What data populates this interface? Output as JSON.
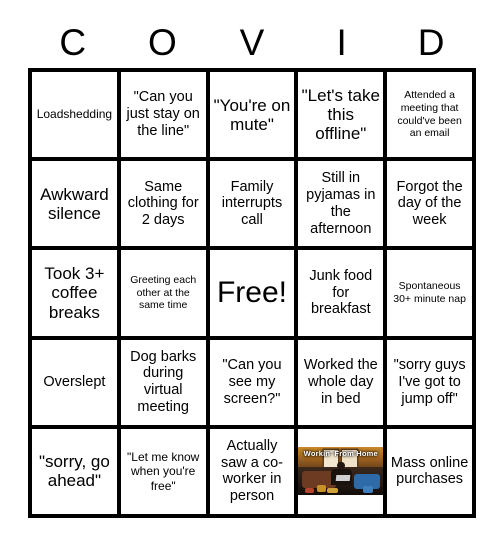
{
  "card": {
    "title_letters": [
      "C",
      "O",
      "V",
      "I",
      "D"
    ],
    "free_space_label": "Free!"
  },
  "grid": {
    "rows": 5,
    "columns": 5,
    "cells": [
      {
        "text": "Loadshedding",
        "size": "s"
      },
      {
        "text": "\"Can you just stay on the line\"",
        "size": "m"
      },
      {
        "text": "\"You're on mute\"",
        "size": "l"
      },
      {
        "text": "\"Let's take this offline\"",
        "size": "l"
      },
      {
        "text": "Attended a meeting that could've been an email",
        "size": "xs"
      },
      {
        "text": "Awkward silence",
        "size": "l"
      },
      {
        "text": "Same clothing for 2 days",
        "size": "m"
      },
      {
        "text": "Family interrupts call",
        "size": "m"
      },
      {
        "text": "Still in pyjamas in the afternoon",
        "size": "m"
      },
      {
        "text": "Forgot the day of the week",
        "size": "m"
      },
      {
        "text": "Took 3+ coffee breaks",
        "size": "l"
      },
      {
        "text": "Greeting each other at the same time",
        "size": "xs"
      },
      {
        "text": "Free!",
        "size": "xl"
      },
      {
        "text": "Junk food for breakfast",
        "size": "m"
      },
      {
        "text": "Spontaneous 30+ minute nap",
        "size": "xs"
      },
      {
        "text": "Overslept",
        "size": "m"
      },
      {
        "text": "Dog barks during virtual meeting",
        "size": "m"
      },
      {
        "text": "\"Can you see my screen?\"",
        "size": "m"
      },
      {
        "text": "Worked the whole day in bed",
        "size": "m"
      },
      {
        "text": "\"sorry guys I've got to jump off\"",
        "size": "m"
      },
      {
        "text": "\"sorry, go ahead\"",
        "size": "l"
      },
      {
        "text": "\"Let me know when you're free\"",
        "size": "s"
      },
      {
        "text": "Actually saw a co-worker in person",
        "size": "m"
      },
      {
        "text": "",
        "size": "m",
        "image": true,
        "image_caption": "Workin' From Home"
      },
      {
        "text": "Mass online purchases",
        "size": "m"
      }
    ]
  },
  "colors": {
    "grid_line": "#000000",
    "cell_background": "#ffffff",
    "page_background": "#ffffff",
    "text": "#000000"
  }
}
